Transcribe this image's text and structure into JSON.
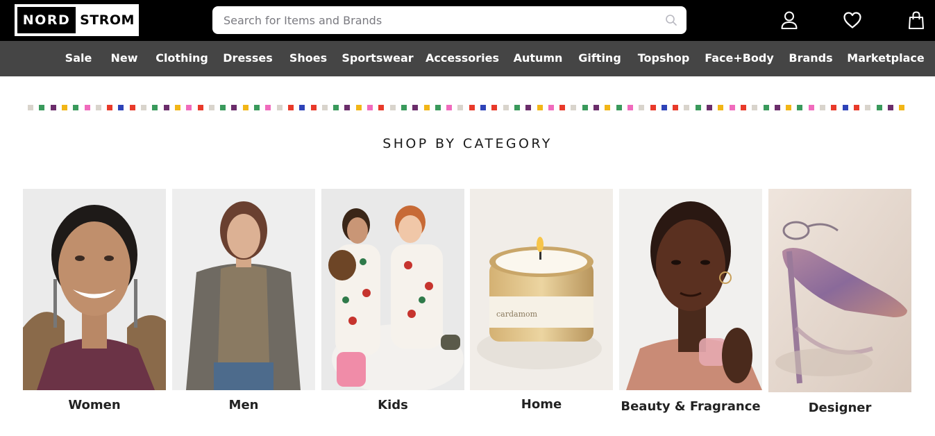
{
  "header": {
    "logo": {
      "left": "NORD",
      "right": "STROM"
    },
    "search": {
      "placeholder": "Search for Items and Brands",
      "value": "",
      "icon": "search-icon"
    },
    "icons": [
      "account-icon",
      "heart-icon",
      "shopping-bag-icon"
    ]
  },
  "nav": {
    "items": [
      "Sale",
      "New",
      "Clothing",
      "Dresses",
      "Shoes",
      "Sportswear",
      "Accessories",
      "Autumn",
      "Gifting",
      "Topshop",
      "Face+Body",
      "Brands",
      "Marketplace"
    ]
  },
  "confetti_colors": [
    "#d9d4cc",
    "#3a9a5c",
    "#6b2d6b",
    "#f2b617",
    "#3a9a5c",
    "#f06bbd",
    "#d9d4cc",
    "#e83a2a",
    "#2e43b8",
    "#e83a2a",
    "#d9d4cc",
    "#3a9a5c",
    "#6b2d6b",
    "#f2b617",
    "#f06bbd",
    "#e83a2a"
  ],
  "main": {
    "heading": "SHOP BY CATEGORY",
    "categories": [
      {
        "label": "Women"
      },
      {
        "label": "Men"
      },
      {
        "label": "Kids"
      },
      {
        "label": "Home"
      },
      {
        "label": "Beauty & Fragrance"
      },
      {
        "label": "Designer"
      }
    ]
  }
}
